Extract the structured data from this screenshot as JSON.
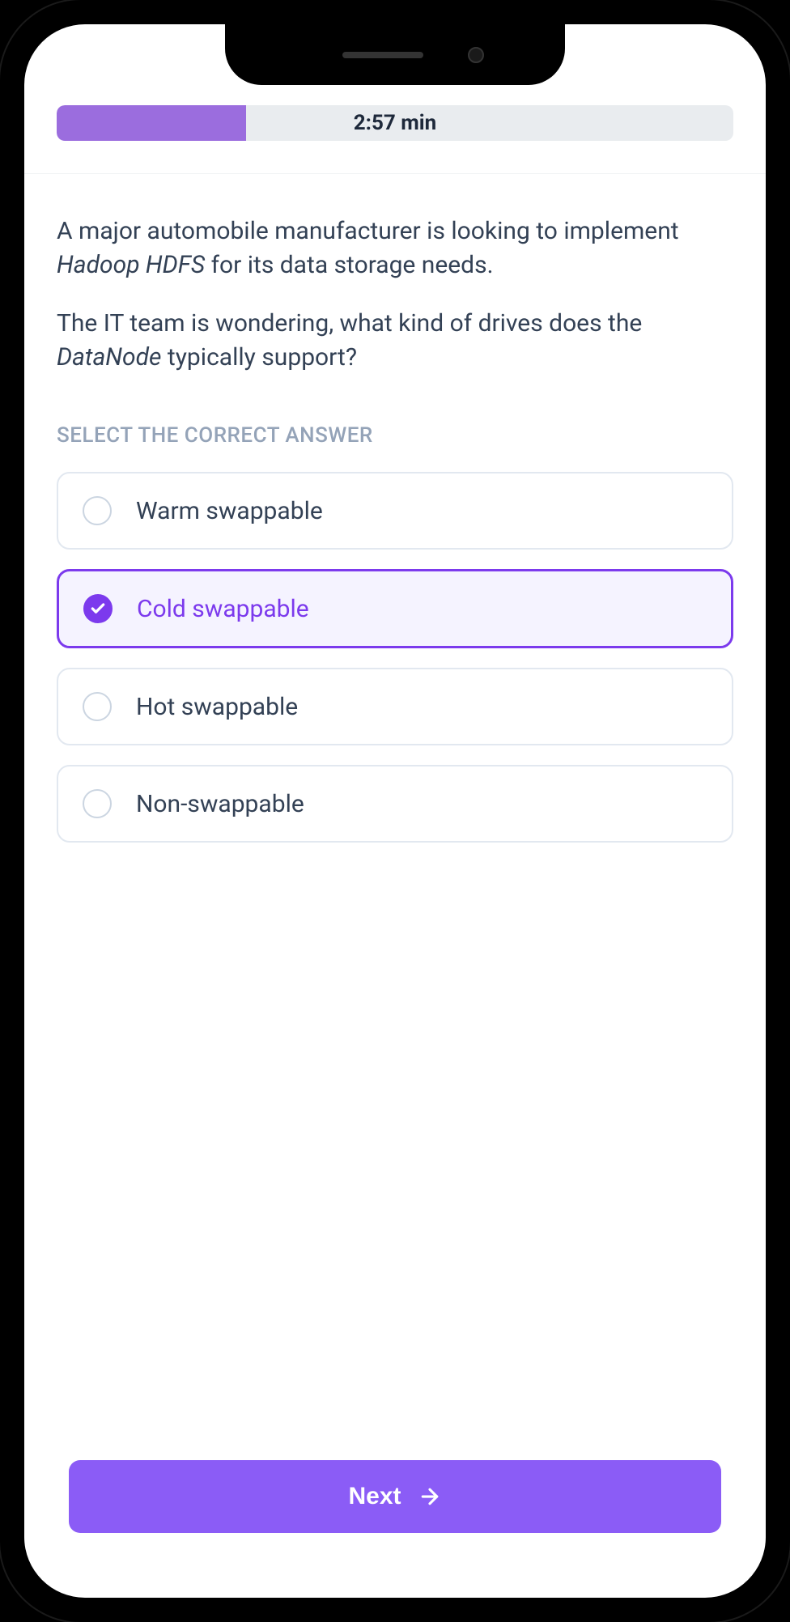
{
  "timer": {
    "display": "2:57 min"
  },
  "question": {
    "paragraph1_pre": "A major automobile manufacturer is looking to implement ",
    "paragraph1_em": "Hadoop HDFS",
    "paragraph1_post": " for its data storage needs.",
    "paragraph2_pre": "The IT team is wondering, what kind of drives does the ",
    "paragraph2_em": "DataNode",
    "paragraph2_post": " typically support?"
  },
  "instruction": "SELECT THE CORRECT ANSWER",
  "answers": [
    {
      "label": "Warm swappable",
      "selected": false
    },
    {
      "label": "Cold swappable",
      "selected": true
    },
    {
      "label": "Hot swappable",
      "selected": false
    },
    {
      "label": "Non-swappable",
      "selected": false
    }
  ],
  "footer": {
    "next_label": "Next"
  },
  "colors": {
    "accent": "#8b5cf6",
    "accent_dark": "#7c3aed",
    "text": "#334155",
    "muted": "#94a3b8"
  }
}
